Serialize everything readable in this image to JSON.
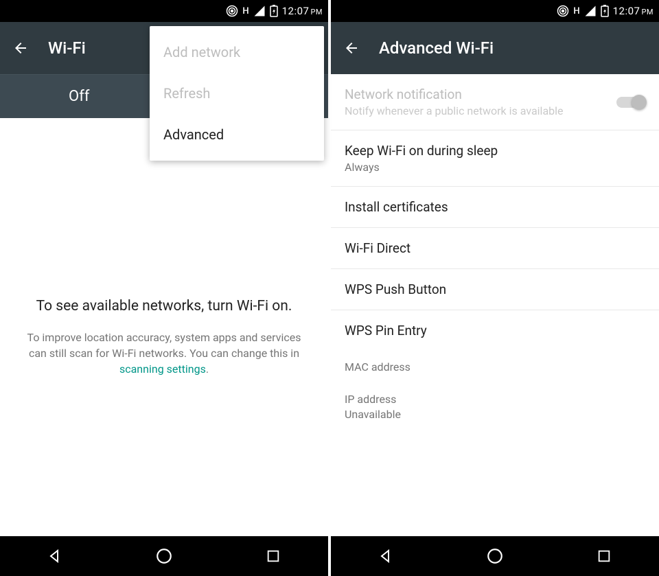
{
  "status": {
    "time": "12:07",
    "ampm": "PM",
    "network_type": "H"
  },
  "left": {
    "title": "Wi-Fi",
    "toggle_label": "Off",
    "menu": {
      "add_network": "Add network",
      "refresh": "Refresh",
      "advanced": "Advanced"
    },
    "empty_title": "To see available networks, turn Wi-Fi on.",
    "empty_sub_pre": "To improve location accuracy, system apps and services can still scan for Wi-Fi networks. You can change this in ",
    "empty_link": "scanning settings",
    "empty_sub_post": "."
  },
  "right": {
    "title": "Advanced Wi-Fi",
    "items": [
      {
        "title": "Network notification",
        "sub": "Notify whenever a public network is available",
        "switch": true,
        "disabled": true
      },
      {
        "title": "Keep Wi-Fi on during sleep",
        "sub": "Always"
      },
      {
        "title": "Install certificates"
      },
      {
        "title": "Wi-Fi Direct"
      },
      {
        "title": "WPS Push Button"
      },
      {
        "title": "WPS Pin Entry"
      }
    ],
    "info": [
      {
        "title": "MAC address",
        "sub": ""
      },
      {
        "title": "IP address",
        "sub": "Unavailable"
      }
    ]
  }
}
